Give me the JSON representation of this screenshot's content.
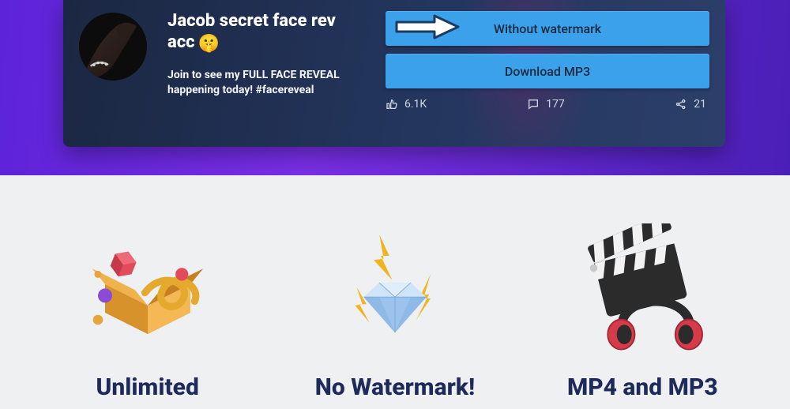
{
  "post": {
    "title": "Jacob secret face rev acc",
    "emoji": "🤫",
    "description": "Join to see my FULL FACE REVEAL happening today! #facereveal"
  },
  "buttons": {
    "without_watermark": "Without watermark",
    "download_mp3": "Download MP3"
  },
  "stats": {
    "likes": "6.1K",
    "comments": "177",
    "shares": "21"
  },
  "features": [
    {
      "title": "Unlimited"
    },
    {
      "title": "No Watermark!"
    },
    {
      "title": "MP4 and MP3"
    }
  ]
}
